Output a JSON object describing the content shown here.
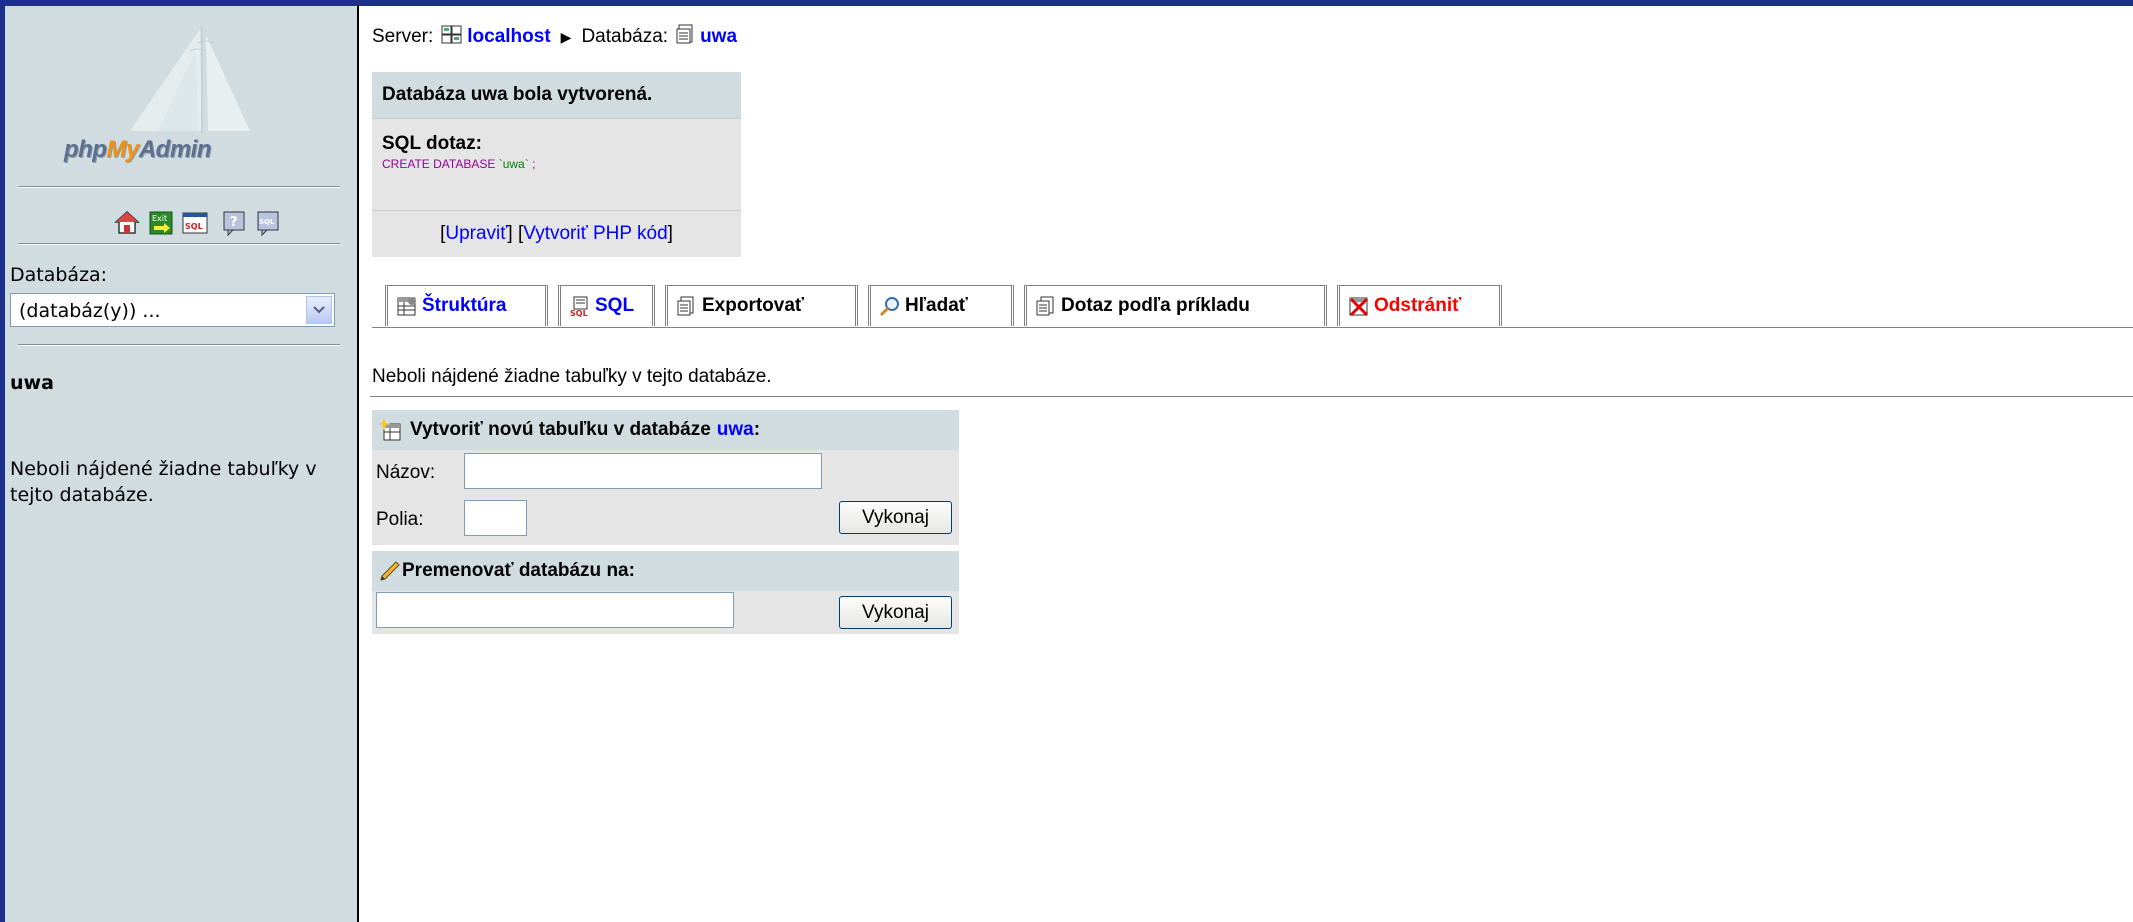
{
  "sidebar": {
    "logo": {
      "php": "php",
      "my": "My",
      "admin": "Admin"
    },
    "icons": [
      "home-icon",
      "exit-icon",
      "sql-query-icon",
      "help-icon",
      "sql-docs-icon"
    ],
    "database_label": "Databáza:",
    "database_select": "(databáz(y)) ...",
    "current_db": "uwa",
    "no_tables": "Neboli nájdené žiadne tabuľky v tejto databáze."
  },
  "breadcrumb": {
    "server_label": "Server:",
    "server_name": "localhost",
    "db_label": "Databáza:",
    "db_name": "uwa"
  },
  "message": {
    "title": "Databáza uwa bola vytvorená.",
    "sql_label": "SQL dotaz:",
    "sql_keyword": "CREATE DATABASE",
    "sql_value": "`uwa`",
    "sql_end": ";",
    "edit_link": "Upraviť",
    "php_link": "Vytvoriť PHP kód"
  },
  "tabs": [
    {
      "label": "Štruktúra",
      "icon": "structure-icon",
      "color": "blue"
    },
    {
      "label": "SQL",
      "icon": "sql-icon",
      "color": "blue"
    },
    {
      "label": "Exportovať",
      "icon": "export-icon",
      "color": "black"
    },
    {
      "label": "Hľadať",
      "icon": "search-icon",
      "color": "black"
    },
    {
      "label": "Dotaz podľa príkladu",
      "icon": "query-icon",
      "color": "black"
    },
    {
      "label": "Odstrániť",
      "icon": "drop-icon",
      "color": "red"
    }
  ],
  "main": {
    "no_tables": "Neboli nájdené žiadne tabuľky v tejto databáze."
  },
  "create_table": {
    "title": "Vytvoriť novú tabuľku v databáze",
    "db_name": "uwa",
    "colon": ":",
    "name_label": "Názov:",
    "name_value": "",
    "fields_label": "Polia:",
    "fields_value": "",
    "submit": "Vykonaj"
  },
  "rename_db": {
    "title": "Premenovať databázu na:",
    "value": "",
    "submit": "Vykonaj"
  },
  "colors": {
    "nav_bg": "#d0dce0",
    "link": "#0000ff",
    "box_bg": "#e5e5e5",
    "accent": "#1c2f8c"
  }
}
